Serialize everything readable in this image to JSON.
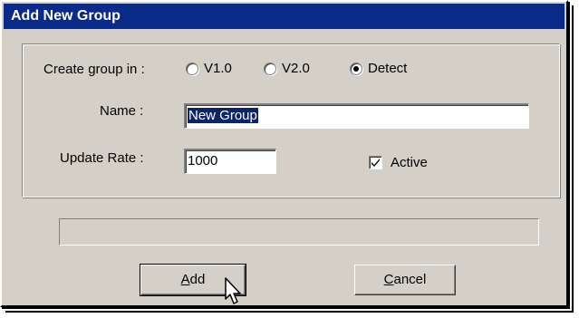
{
  "window": {
    "title": "Add New Group"
  },
  "create_group": {
    "label": "Create group in :",
    "options": [
      {
        "label": "V1.0",
        "selected": false
      },
      {
        "label": "V2.0",
        "selected": false
      },
      {
        "label": "Detect",
        "selected": true
      }
    ]
  },
  "name": {
    "label": "Name :",
    "value": "New Group"
  },
  "update_rate": {
    "label": "Update Rate :",
    "value": "1000"
  },
  "active": {
    "label": "Active",
    "checked": true
  },
  "buttons": {
    "add": {
      "mnemonic": "A",
      "rest": "dd"
    },
    "cancel": {
      "mnemonic": "C",
      "rest": "ancel"
    }
  },
  "progress": {
    "fraction": 0
  },
  "icons": {
    "cursor": "arrow-pointer-icon",
    "check": "checkmark-icon"
  }
}
